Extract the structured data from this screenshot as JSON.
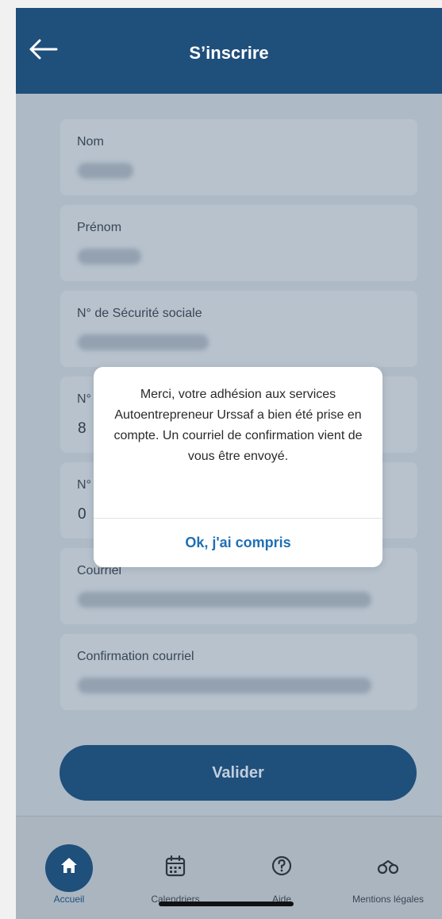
{
  "header": {
    "title": "S’inscrire",
    "back_icon": "arrow-left-icon"
  },
  "form": {
    "fields": [
      {
        "label": "Nom"
      },
      {
        "label": "Prénom"
      },
      {
        "label": "N° de Sécurité sociale"
      },
      {
        "label": "N°",
        "partial_value": "8"
      },
      {
        "label": "N°",
        "partial_value": "0"
      },
      {
        "label": "Courriel"
      },
      {
        "label": "Confirmation courriel"
      }
    ],
    "submit_label": "Valider"
  },
  "modal": {
    "message": "Merci, votre adhésion aux services Autoentrepreneur Urssaf a bien été prise en compte. Un courriel de confirmation vient de vous être envoyé.",
    "ok_label": "Ok, j'ai compris"
  },
  "tabbar": {
    "items": [
      {
        "label": "Accueil",
        "icon": "home-icon",
        "active": true
      },
      {
        "label": "Calendriers",
        "icon": "calendar-icon"
      },
      {
        "label": "Aide",
        "icon": "help-icon"
      },
      {
        "label": "Mentions légales",
        "icon": "balance-icon"
      }
    ]
  },
  "colors": {
    "primary": "#1f4f7b",
    "link": "#1f6fb3",
    "overlay": "#aebac6"
  }
}
